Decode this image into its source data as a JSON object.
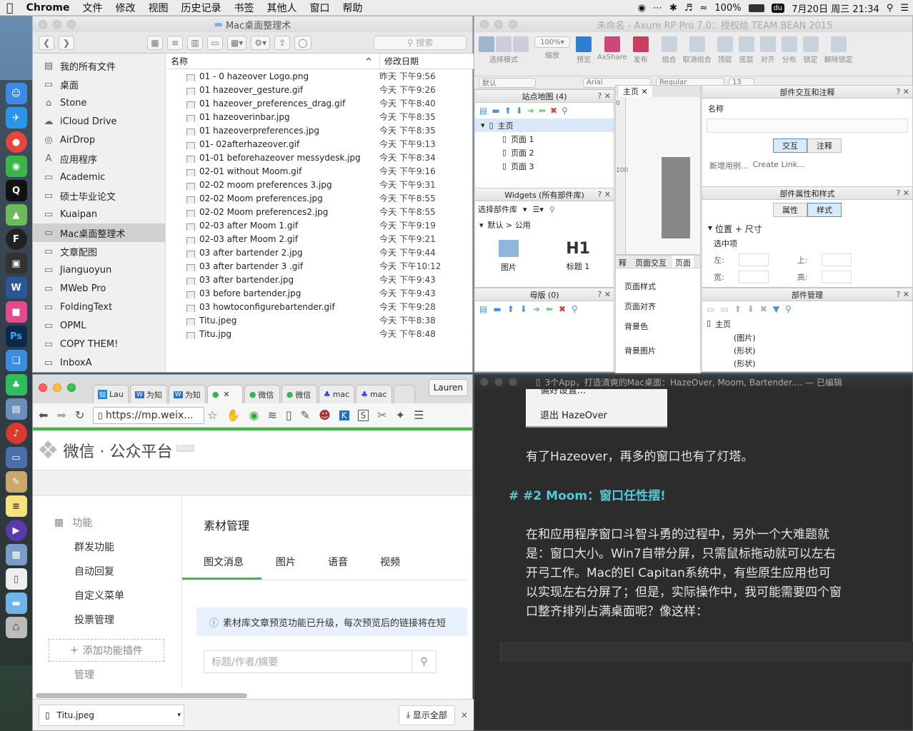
{
  "menubar": {
    "app": "Chrome",
    "items": [
      "文件",
      "修改",
      "视图",
      "历史记录",
      "书签",
      "其他人",
      "窗口",
      "帮助"
    ],
    "battery": "100%",
    "datetime": "7月20日 周三  21:34"
  },
  "dock": {
    "items": [
      "finder-icon",
      "safari-icon",
      "chrome-icon",
      "wechat-icon",
      "qq-icon",
      "maps-icon",
      "app-f-icon",
      "terminal-icon",
      "word-icon",
      "photos-icon",
      "photoshop-icon",
      "books-icon",
      "evernote-icon",
      "preview-icon",
      "netease-icon",
      "screen-icon",
      "pen-icon",
      "notes-icon",
      "video-icon",
      "image-icon",
      "file-icon",
      "folder-icon",
      "trash-icon"
    ]
  },
  "finder": {
    "title": "Mac桌面整理术",
    "search_placeholder": "搜索",
    "sidebar": [
      {
        "label": "我的所有文件",
        "icon": "all-files-icon"
      },
      {
        "label": "桌面",
        "icon": "desktop-icon"
      },
      {
        "label": "Stone",
        "icon": "home-icon"
      },
      {
        "label": "iCloud Drive",
        "icon": "cloud-icon"
      },
      {
        "label": "AirDrop",
        "icon": "airdrop-icon"
      },
      {
        "label": "应用程序",
        "icon": "apps-icon"
      },
      {
        "label": "Academic",
        "icon": "folder-icon"
      },
      {
        "label": "硕士毕业论文",
        "icon": "folder-icon"
      },
      {
        "label": "Kuaipan",
        "icon": "folder-icon"
      },
      {
        "label": "Mac桌面整理术",
        "icon": "folder-icon"
      },
      {
        "label": "文章配图",
        "icon": "folder-icon"
      },
      {
        "label": "Jianguoyun",
        "icon": "folder-icon"
      },
      {
        "label": "MWeb Pro",
        "icon": "folder-icon"
      },
      {
        "label": "FoldingText",
        "icon": "folder-icon"
      },
      {
        "label": "OPML",
        "icon": "folder-icon"
      },
      {
        "label": "COPY THEM!",
        "icon": "folder-icon"
      },
      {
        "label": "InboxA",
        "icon": "folder-icon"
      }
    ],
    "columns": {
      "name": "名称",
      "date": "修改日期"
    },
    "files": [
      {
        "name": "01 - 0 hazeover Logo.png",
        "date": "昨天 下午9:56"
      },
      {
        "name": "01 hazeover_gesture.gif",
        "date": "今天 下午9:26"
      },
      {
        "name": "01 hazeover_preferences_drag.gif",
        "date": "今天 下午8:40"
      },
      {
        "name": "01 hazeoverinbar.jpg",
        "date": "今天 下午8:35"
      },
      {
        "name": "01 hazeoverpreferences.jpg",
        "date": "今天 下午8:35"
      },
      {
        "name": "01- 02afterhazeover.gif",
        "date": "今天 下午9:13"
      },
      {
        "name": "01-01 beforehazeover messydesk.jpg",
        "date": "今天 下午8:34"
      },
      {
        "name": "02-01 without Moom.gif",
        "date": "今天 下午9:16"
      },
      {
        "name": "02-02 moom preferences 3.jpg",
        "date": "今天 下午9:31"
      },
      {
        "name": "02-02 Moom preferences.jpg",
        "date": "今天 下午8:55"
      },
      {
        "name": "02-02 Moom preferences2.jpg",
        "date": "今天 下午8:55"
      },
      {
        "name": "02-03 after Moom 1.gif",
        "date": "今天 下午9:19"
      },
      {
        "name": "02-03 after Moom 2.gif",
        "date": "今天 下午9:21"
      },
      {
        "name": "03 after bartender 2.jpg",
        "date": "今天 下午9:44"
      },
      {
        "name": "03 after bartender 3 .gif",
        "date": "今天 下午10:12"
      },
      {
        "name": "03 after bartender.jpg",
        "date": "今天 下午9:43"
      },
      {
        "name": "03 before bartender.jpg",
        "date": "今天 下午9:43"
      },
      {
        "name": "03 howtoconfigurebartender.gif",
        "date": "今天 下午9:28"
      },
      {
        "name": "Titu.jpeg",
        "date": "今天 下午8:38"
      },
      {
        "name": "Titu.jpg",
        "date": "今天 下午8:48"
      }
    ]
  },
  "axure": {
    "title": "未命名 - Axure RP Pro 7.0：授权给 TEAM BEAN 2015",
    "zoom": "100%",
    "toolbar_labels": {
      "select_mode": "选择模式",
      "zoom": "缩放",
      "preview": "预览",
      "axshare": "AxShare",
      "publish": "发布",
      "group": "组合",
      "ungroup": "取消组合",
      "top": "顶层",
      "bottom": "底层",
      "align": "对齐",
      "distribute": "分布",
      "lock": "锁定",
      "unlock": "解除锁定"
    },
    "format": {
      "style": "默认",
      "font": "Arial",
      "weight": "Regular",
      "size": "13"
    },
    "sitemap": {
      "header": "站点地图 (4)",
      "root": "主页",
      "pages": [
        "页面 1",
        "页面 2",
        "页面 3"
      ]
    },
    "widgets": {
      "header": "Widgets (所有部件库)",
      "library": "选择部件库",
      "group": "默认 > 公用",
      "image_label": "图片",
      "h1_glyph": "H1",
      "h1_label": "标题 1"
    },
    "masters": {
      "header": "母版 (0)"
    },
    "canvas_tab": "主页",
    "ruler": {
      "top": "0",
      "mid": "100"
    },
    "page_tabs": [
      "释",
      "页面交互",
      "页面"
    ],
    "page_props": [
      "页面样式",
      "页面对齐",
      "背景色",
      "背景图片"
    ],
    "interaction": {
      "header": "部件交互和注释",
      "name_label": "名称",
      "tab_interact": "交互",
      "tab_notes": "注释",
      "new_case": "新增用例...",
      "create_link": "Create Link..."
    },
    "props": {
      "header": "部件属性和样式",
      "tab_props": "属性",
      "tab_style": "样式",
      "section": "位置 + 尺寸",
      "selected": "选中项",
      "left": "左:",
      "top": "上:",
      "width": "宽:",
      "height": "高:"
    },
    "manager": {
      "header": "部件管理",
      "root": "主页",
      "items": [
        "(图片)",
        "(形状)",
        "(形状)"
      ]
    }
  },
  "chrome": {
    "tabs": [
      "Lau",
      "为知",
      "为知",
      "",
      "微信",
      "微信",
      "mac",
      "mac",
      ""
    ],
    "profile": "Lauren",
    "url": "https://mp.weix...",
    "wx_title": "微信 · 公众平台",
    "wx_beta": "Beta",
    "nav_header": "功能",
    "nav_items": [
      "群发功能",
      "自动回复",
      "自定义菜单",
      "投票管理"
    ],
    "add_plugin": "添加功能插件",
    "nav_next": "管理",
    "main_title": "素材管理",
    "main_tabs": [
      "图文消息",
      "图片",
      "语音",
      "视频"
    ],
    "notice": "素材库文章预览功能已升级，每次预览后的链接将在短",
    "search_placeholder": "标题/作者/摘要",
    "download": {
      "file": "Titu.jpeg",
      "show_all": "显示全部"
    }
  },
  "editor": {
    "title": "3个App，打造清爽的Mac桌面：HazeOver, Moom, Bartender.... — 已编辑",
    "menu_partial": "偏好设置...",
    "menu_quit": "退出 HazeOver",
    "line1": "有了Hazeover，再多的窗口也有了灯塔。",
    "heading": "# #2  Moom：窗口任性摆!",
    "para": [
      "在和应用程序窗口斗智斗勇的过程中，另外一个大难题就",
      "是：窗口大小。Win7自带分屏，只需鼠标拖动就可以左右",
      "开弓工作。Mac的El Capitan系统中，有些原生应用也可",
      "以实现左右分屏了；但是，实际操作中，我可能需要四个窗",
      "口整齐排列占满桌面呢？像这样："
    ]
  }
}
